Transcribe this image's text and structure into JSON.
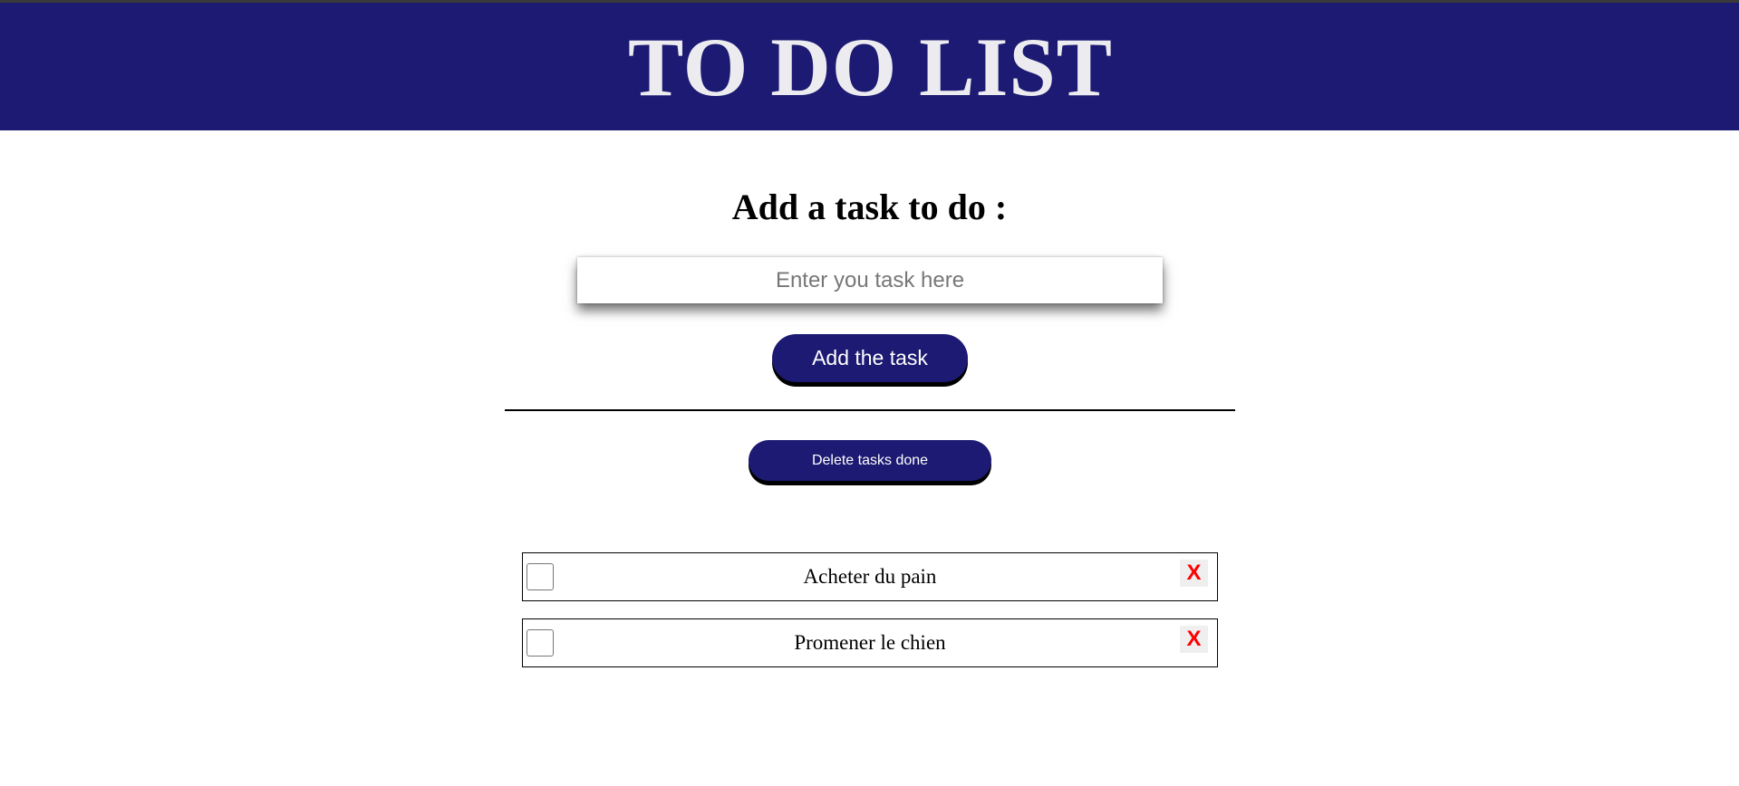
{
  "header": {
    "title": "TO DO LIST"
  },
  "form": {
    "heading": "Add a task to do :",
    "input_placeholder": "Enter you task here",
    "add_label": "Add the task"
  },
  "actions": {
    "delete_done_label": "Delete tasks done"
  },
  "tasks": [
    {
      "text": "Acheter du pain",
      "done": false,
      "delete_label": "X"
    },
    {
      "text": "Promener le chien",
      "done": false,
      "delete_label": "X"
    }
  ],
  "colors": {
    "brand": "#1c1a72",
    "delete": "#ff0000"
  }
}
